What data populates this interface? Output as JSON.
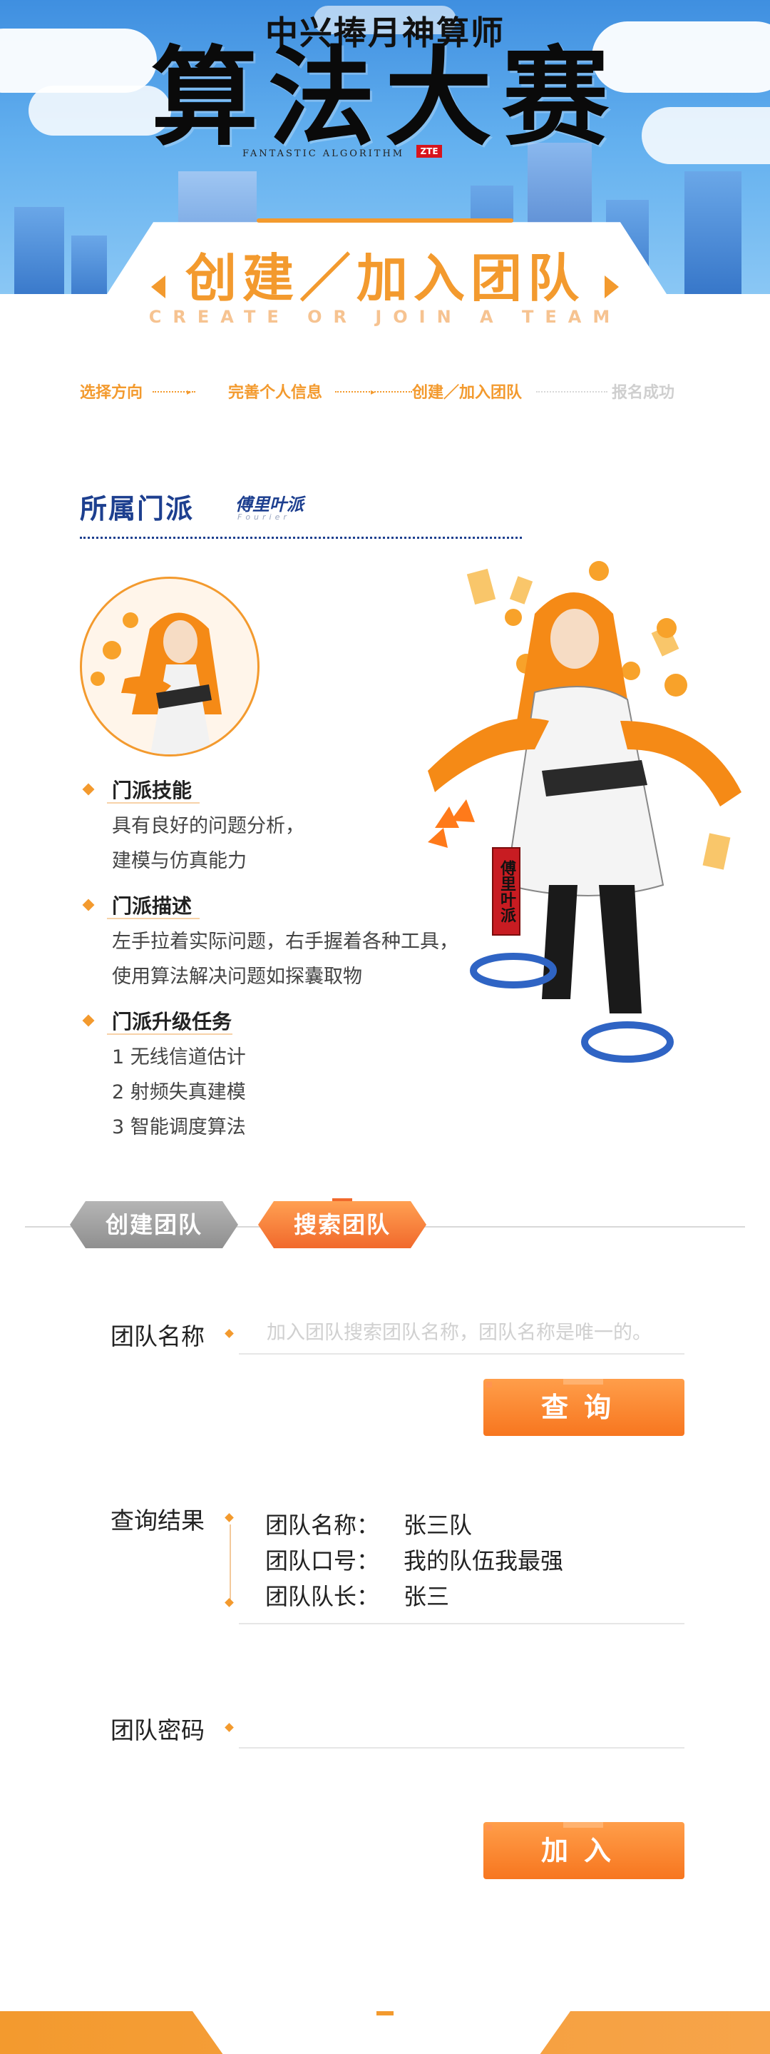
{
  "banner": {
    "event_subtitle": "中兴捧月神算师",
    "event_title": "算法大赛",
    "event_title_en": "FANTASTIC ALGORITHM",
    "logo": "ZTE"
  },
  "page": {
    "title": "创建／加入团队",
    "subtitle": "CREATE OR JOIN A TEAM"
  },
  "steps": [
    {
      "label": "选择方向",
      "status": "done"
    },
    {
      "label": "完善个人信息",
      "status": "done"
    },
    {
      "label": "创建／加入团队",
      "status": "done"
    },
    {
      "label": "报名成功",
      "status": "todo"
    }
  ],
  "sect": {
    "heading": "所属门派",
    "faction_name": "傅里叶派",
    "faction_name_en": "Fourier",
    "banner_tag": "傅里叶派"
  },
  "info": {
    "skill": {
      "title": "门派技能",
      "lines": [
        "具有良好的问题分析，",
        "建模与仿真能力"
      ]
    },
    "description": {
      "title": "门派描述",
      "lines": [
        "左手拉着实际问题，右手握着各种工具，",
        "使用算法解决问题如探囊取物"
      ]
    },
    "tasks": {
      "title": "门派升级任务",
      "lines": [
        "1 无线信道估计",
        "2 射频失真建模",
        "3 智能调度算法"
      ]
    }
  },
  "tabs": {
    "create": "创建团队",
    "search": "搜索团队",
    "active": "search"
  },
  "form": {
    "team_name_label": "团队名称",
    "team_name_placeholder": "加入团队搜索团队名称，团队名称是唯一的。",
    "query_button": "查询",
    "result_label": "查询结果",
    "results": [
      {
        "key": "团队名称：",
        "value": "张三队"
      },
      {
        "key": "团队口号：",
        "value": "我的队伍我最强"
      },
      {
        "key": "团队队长：",
        "value": "张三"
      }
    ],
    "password_label": "团队密码",
    "password_value": "",
    "join_button": "加入"
  },
  "colors": {
    "accent": "#f39a2e",
    "accent_dark": "#f1692c",
    "navy": "#1d3f8f",
    "inactive_tab": "#9e9e9e"
  }
}
